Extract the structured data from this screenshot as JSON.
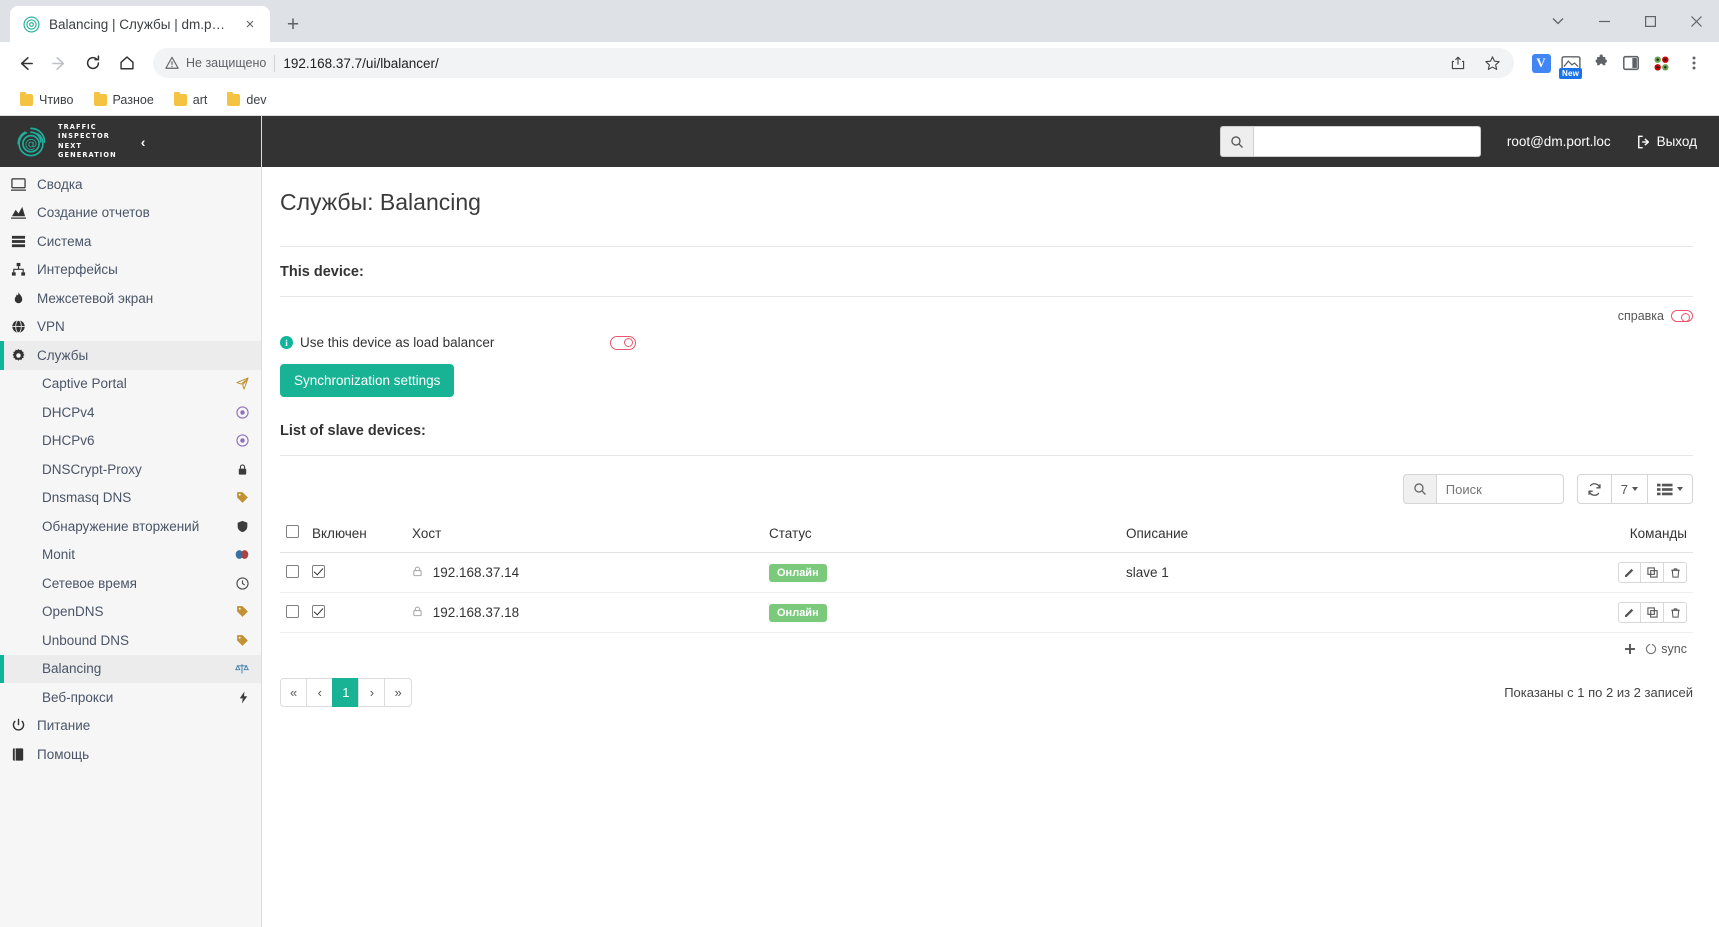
{
  "browser": {
    "tab": {
      "title": "Balancing | Службы | dm.port.loc",
      "favicon": "fingerprint-at-icon",
      "close": "×"
    },
    "new_tab": "+",
    "window_controls": {
      "dropdown": "⌄",
      "minimize": "—",
      "maximize": "□",
      "close": "✕"
    },
    "nav": {
      "back": "←",
      "forward": "→",
      "reload": "⟳",
      "home": "⌂"
    },
    "omnibox": {
      "security_label": "Не защищено",
      "url": "192.168.37.7/ui/lbalancer/",
      "share_icon": "share-icon",
      "bookmark_icon": "star-icon"
    },
    "extensions": [
      {
        "name": "vimium-extension",
        "label": "V"
      },
      {
        "name": "screenshot-extension",
        "badge": "New"
      },
      {
        "name": "puzzle-extensions-icon",
        "label": ""
      },
      {
        "name": "sidepanel-icon",
        "label": ""
      },
      {
        "name": "colorpicker-extension",
        "label": ""
      }
    ],
    "menu": "⋮",
    "bookmarks": [
      {
        "label": "Чтиво"
      },
      {
        "label": "Разное"
      },
      {
        "label": "art"
      },
      {
        "label": "dev"
      }
    ]
  },
  "brand": {
    "line1": "TRAFFIC",
    "line2": "INSPECTOR",
    "line3": "NEXT",
    "line4": "GENERATION",
    "collapse": "‹"
  },
  "topbar": {
    "search_value": "",
    "search_placeholder": "",
    "user": "root@dm.port.loc",
    "logout": "Выход"
  },
  "sidebar": {
    "items": [
      {
        "label": "Сводка",
        "icon": "monitor-icon",
        "active": false
      },
      {
        "label": "Создание отчетов",
        "icon": "chart-icon",
        "active": false
      },
      {
        "label": "Система",
        "icon": "server-icon",
        "active": false
      },
      {
        "label": "Интерфейсы",
        "icon": "sitemap-icon",
        "active": false
      },
      {
        "label": "Межсетевой экран",
        "icon": "fire-icon",
        "active": false
      },
      {
        "label": "VPN",
        "icon": "globe-icon",
        "active": false
      },
      {
        "label": "Службы",
        "icon": "gear-icon",
        "active": true
      }
    ],
    "sub_items": [
      {
        "label": "Captive Portal",
        "icon": "paperplane-icon"
      },
      {
        "label": "DHCPv4",
        "icon": "target-icon"
      },
      {
        "label": "DHCPv6",
        "icon": "target-icon"
      },
      {
        "label": "DNSCrypt-Proxy",
        "icon": "lock-icon"
      },
      {
        "label": "Dnsmasq DNS",
        "icon": "tag-icon"
      },
      {
        "label": "Обнаружение вторжений",
        "icon": "shield-icon"
      },
      {
        "label": "Monit",
        "icon": "masks-icon"
      },
      {
        "label": "Сетевое время",
        "icon": "clock-icon"
      },
      {
        "label": "OpenDNS",
        "icon": "tag-icon"
      },
      {
        "label": "Unbound DNS",
        "icon": "tag-icon"
      },
      {
        "label": "Balancing",
        "icon": "balance-icon",
        "active": true
      },
      {
        "label": "Веб-прокси",
        "icon": "bolt-icon"
      }
    ],
    "bottom_items": [
      {
        "label": "Питание",
        "icon": "power-icon"
      },
      {
        "label": "Помощь",
        "icon": "book-icon"
      }
    ]
  },
  "page": {
    "title": "Службы: Balancing",
    "device_section": "This device:",
    "help_link": "справка",
    "toggle_label": "Use this device as load balancer",
    "toggle_state": "off",
    "sync_button": "Synchronization settings",
    "slaves_section": "List of slave devices:"
  },
  "table": {
    "search_value": "",
    "search_placeholder": "Поиск",
    "refresh_icon": "refresh-icon",
    "page_size": "7",
    "columns_icon": "columns-icon",
    "columns": [
      "",
      "Включен",
      "Хост",
      "Статус",
      "Описание",
      "Команды"
    ],
    "rows": [
      {
        "selected": false,
        "enabled": true,
        "host": "192.168.37.14",
        "status": "Онлайн",
        "description": "slave 1"
      },
      {
        "selected": false,
        "enabled": true,
        "host": "192.168.37.18",
        "status": "Онлайн",
        "description": ""
      }
    ],
    "footer": {
      "add": "+",
      "sync": "sync"
    },
    "pagination": {
      "first": "«",
      "prev": "‹",
      "pages": [
        "1"
      ],
      "next": "›",
      "last": "»",
      "active": "1"
    },
    "records_text": "Показаны с 1 по 2 из 2 записей"
  },
  "colors": {
    "accent": "#17b394",
    "topbar": "#333333",
    "online": "#7bc97b",
    "toggle_off": "#e8556d"
  }
}
